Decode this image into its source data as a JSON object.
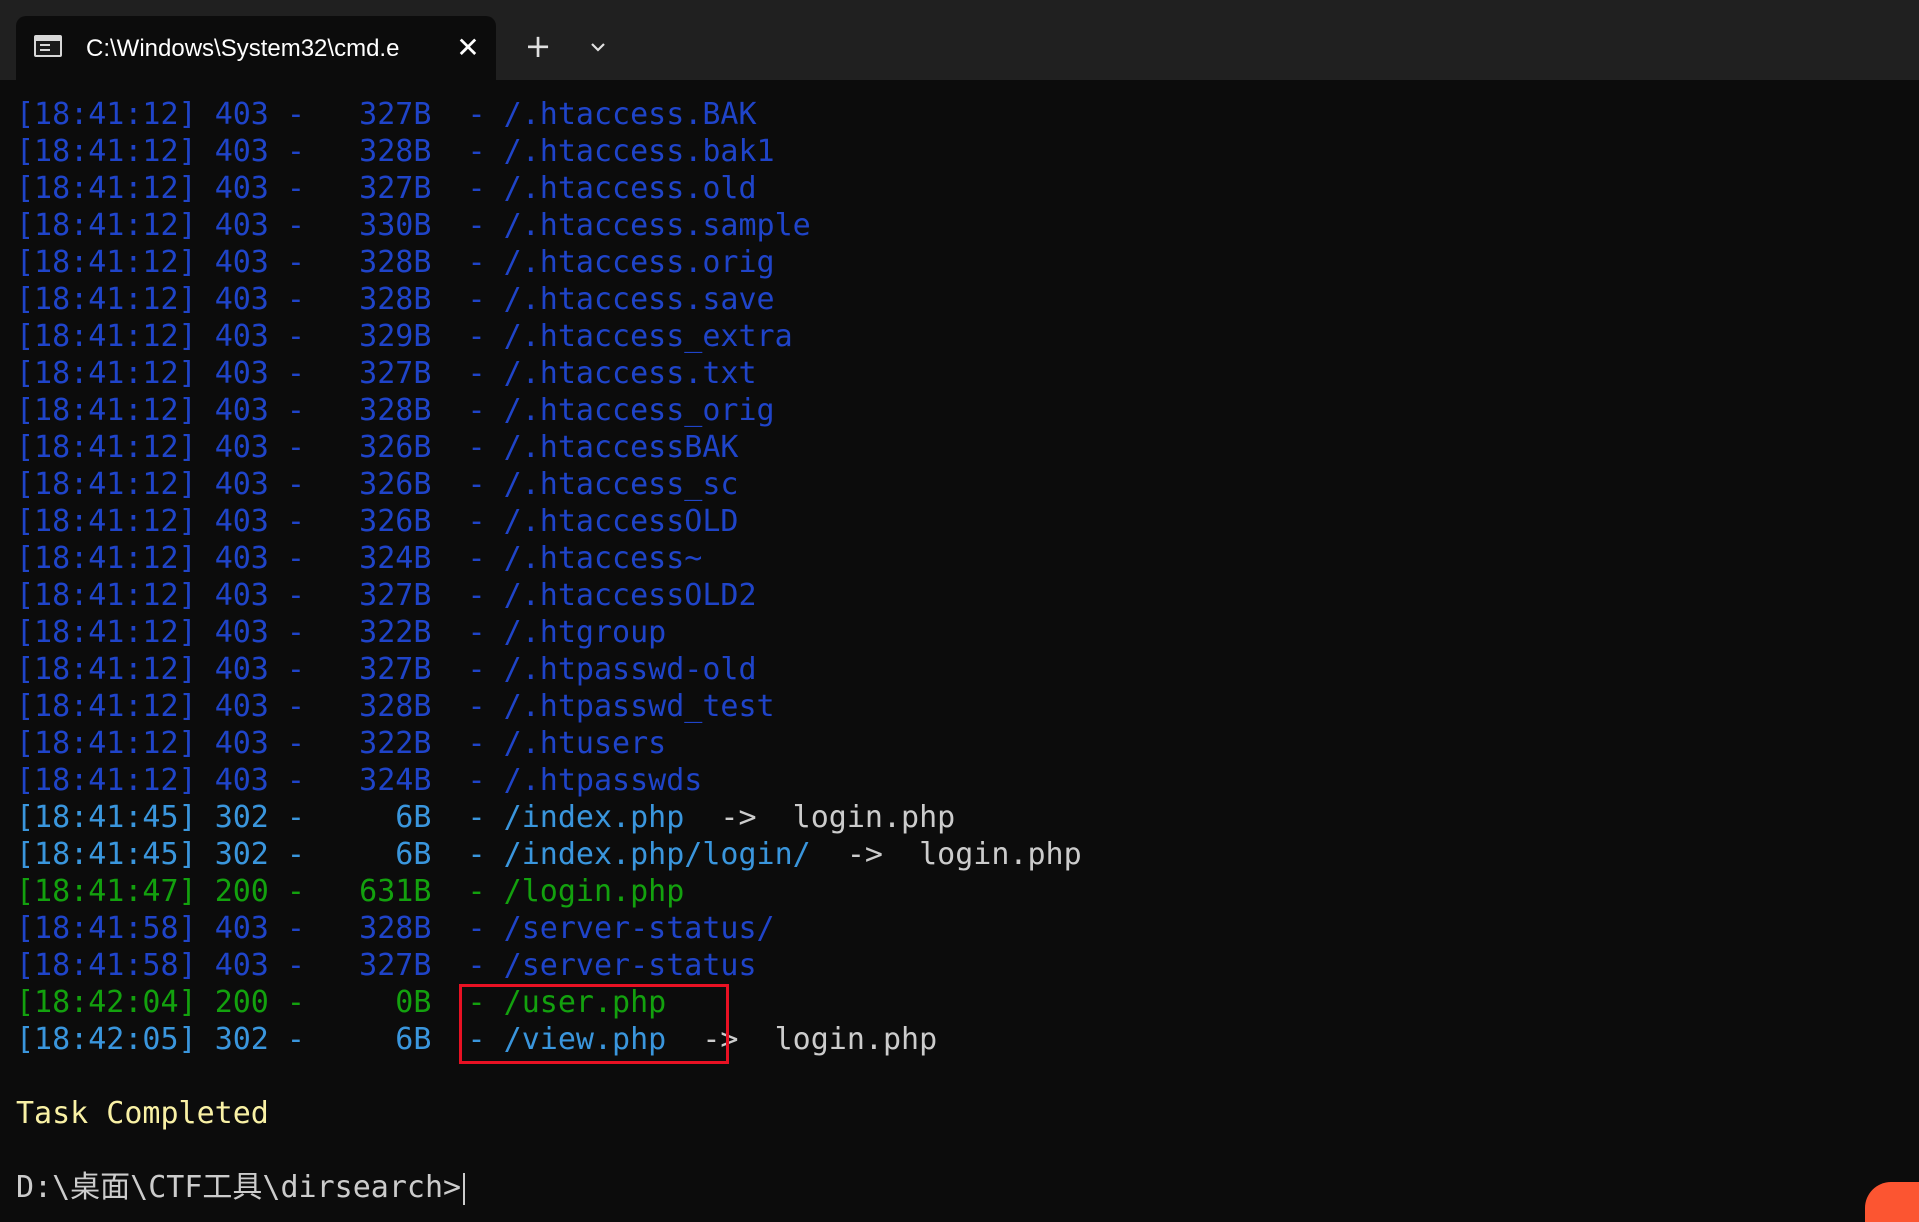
{
  "tab": {
    "title": "C:\\Windows\\System32\\cmd.e",
    "icon": "terminal-icon",
    "close_label": "✕",
    "new_tab_label": "+",
    "dropdown_icon": "chevron-down-icon"
  },
  "console": {
    "lines": [
      {
        "time": "[18:41:12]",
        "status": "403",
        "size": "327B",
        "path": "/.htaccess.BAK",
        "redirect": "",
        "color": "blue"
      },
      {
        "time": "[18:41:12]",
        "status": "403",
        "size": "328B",
        "path": "/.htaccess.bak1",
        "redirect": "",
        "color": "blue"
      },
      {
        "time": "[18:41:12]",
        "status": "403",
        "size": "327B",
        "path": "/.htaccess.old",
        "redirect": "",
        "color": "blue"
      },
      {
        "time": "[18:41:12]",
        "status": "403",
        "size": "330B",
        "path": "/.htaccess.sample",
        "redirect": "",
        "color": "blue"
      },
      {
        "time": "[18:41:12]",
        "status": "403",
        "size": "328B",
        "path": "/.htaccess.orig",
        "redirect": "",
        "color": "blue"
      },
      {
        "time": "[18:41:12]",
        "status": "403",
        "size": "328B",
        "path": "/.htaccess.save",
        "redirect": "",
        "color": "blue"
      },
      {
        "time": "[18:41:12]",
        "status": "403",
        "size": "329B",
        "path": "/.htaccess_extra",
        "redirect": "",
        "color": "blue"
      },
      {
        "time": "[18:41:12]",
        "status": "403",
        "size": "327B",
        "path": "/.htaccess.txt",
        "redirect": "",
        "color": "blue"
      },
      {
        "time": "[18:41:12]",
        "status": "403",
        "size": "328B",
        "path": "/.htaccess_orig",
        "redirect": "",
        "color": "blue"
      },
      {
        "time": "[18:41:12]",
        "status": "403",
        "size": "326B",
        "path": "/.htaccessBAK",
        "redirect": "",
        "color": "blue"
      },
      {
        "time": "[18:41:12]",
        "status": "403",
        "size": "326B",
        "path": "/.htaccess_sc",
        "redirect": "",
        "color": "blue"
      },
      {
        "time": "[18:41:12]",
        "status": "403",
        "size": "326B",
        "path": "/.htaccessOLD",
        "redirect": "",
        "color": "blue"
      },
      {
        "time": "[18:41:12]",
        "status": "403",
        "size": "324B",
        "path": "/.htaccess~",
        "redirect": "",
        "color": "blue"
      },
      {
        "time": "[18:41:12]",
        "status": "403",
        "size": "327B",
        "path": "/.htaccessOLD2",
        "redirect": "",
        "color": "blue"
      },
      {
        "time": "[18:41:12]",
        "status": "403",
        "size": "322B",
        "path": "/.htgroup",
        "redirect": "",
        "color": "blue"
      },
      {
        "time": "[18:41:12]",
        "status": "403",
        "size": "327B",
        "path": "/.htpasswd-old",
        "redirect": "",
        "color": "blue"
      },
      {
        "time": "[18:41:12]",
        "status": "403",
        "size": "328B",
        "path": "/.htpasswd_test",
        "redirect": "",
        "color": "blue"
      },
      {
        "time": "[18:41:12]",
        "status": "403",
        "size": "322B",
        "path": "/.htusers",
        "redirect": "",
        "color": "blue"
      },
      {
        "time": "[18:41:12]",
        "status": "403",
        "size": "324B",
        "path": "/.htpasswds",
        "redirect": "",
        "color": "blue"
      },
      {
        "time": "[18:41:45]",
        "status": "302",
        "size": "6B",
        "path": "/index.php",
        "redirect": "login.php",
        "color": "cyan"
      },
      {
        "time": "[18:41:45]",
        "status": "302",
        "size": "6B",
        "path": "/index.php/login/",
        "redirect": "login.php",
        "color": "cyan"
      },
      {
        "time": "[18:41:47]",
        "status": "200",
        "size": "631B",
        "path": "/login.php",
        "redirect": "",
        "color": "green"
      },
      {
        "time": "[18:41:58]",
        "status": "403",
        "size": "328B",
        "path": "/server-status/",
        "redirect": "",
        "color": "blue"
      },
      {
        "time": "[18:41:58]",
        "status": "403",
        "size": "327B",
        "path": "/server-status",
        "redirect": "",
        "color": "blue"
      },
      {
        "time": "[18:42:04]",
        "status": "200",
        "size": "0B",
        "path": "/user.php",
        "redirect": "",
        "color": "green"
      },
      {
        "time": "[18:42:05]",
        "status": "302",
        "size": "6B",
        "path": "/view.php",
        "redirect": "login.php",
        "color": "cyan"
      }
    ],
    "task_completed": "Task Completed",
    "prompt": "D:\\桌面\\CTF工具\\dirsearch>"
  },
  "colors": {
    "blue": "#1f44c9",
    "cyan": "#3a96dd",
    "green": "#13a10e",
    "white": "#cccccc",
    "yellow": "#f9f1a5",
    "highlight": "#e81123"
  }
}
